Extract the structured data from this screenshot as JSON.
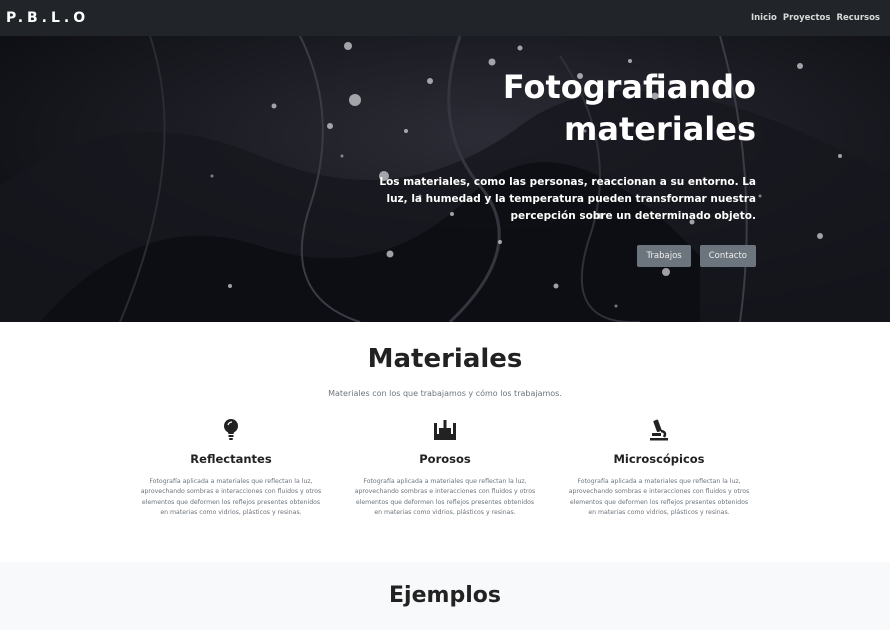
{
  "navbar": {
    "brand": "P.B.L.O",
    "links": [
      "Inicio",
      "Proyectos",
      "Recursos"
    ]
  },
  "hero": {
    "title": "Fotografiando materiales",
    "lead": "Los materiales, como las personas, reaccionan a su entorno. La luz, la humedad y la temperatura pueden transformar nuestra percepción sobre un determinado objeto.",
    "buttons": [
      "Trabajos",
      "Contacto"
    ]
  },
  "materials": {
    "title": "Materiales",
    "subtitle": "Materiales con los que trabajamos y cómo los trabajamos.",
    "features": [
      {
        "icon": "lightbulb-icon",
        "title": "Reflectantes",
        "text": "Fotografía aplicada a materiales que reflectan la luz, aprovechando sombras e interacciones con fluidos y otros elementos que deformen los reflejos presentes obtenidos en materias como vidrios, plásticos y resinas."
      },
      {
        "icon": "water-glass-icon",
        "title": "Porosos",
        "text": "Fotografía aplicada a materiales que reflectan la luz, aprovechando sombras e interacciones con fluidos y otros elementos que deformen los reflejos presentes obtenidos en materias como vidrios, plásticos y resinas."
      },
      {
        "icon": "microscope-icon",
        "title": "Microscópicos",
        "text": "Fotografía aplicada a materiales que reflectan la luz, aprovechando sombras e interacciones con fluidos y otros elementos que deformen los reflejos presentes obtenidos en materias como vidrios, plásticos y resinas."
      }
    ]
  },
  "examples": {
    "title": "Ejemplos"
  },
  "colors": {
    "navbar_bg": "#212529",
    "hero_bg": "#101117",
    "button_bg": "#6c757d",
    "section_alt_bg": "#f8f9fa"
  }
}
